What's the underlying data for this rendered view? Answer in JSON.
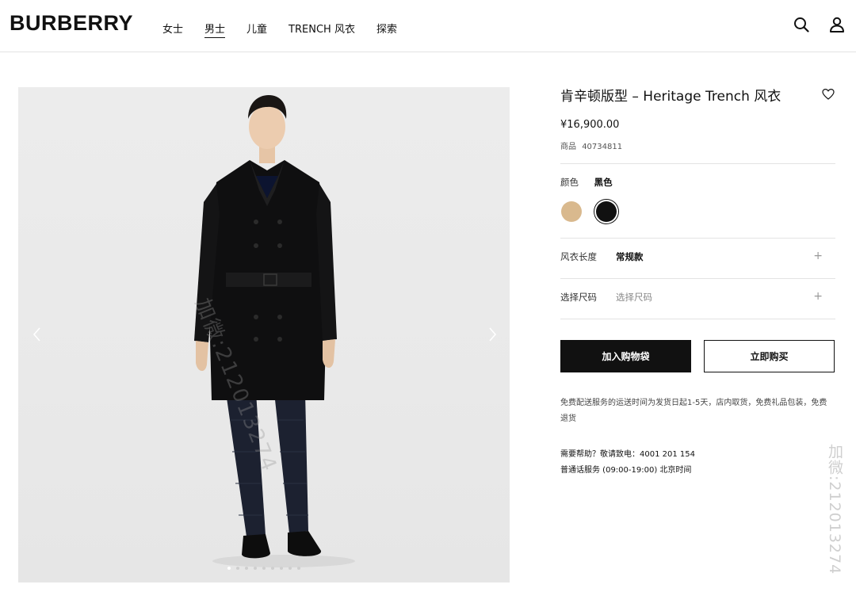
{
  "header": {
    "logo": "BURBERRY",
    "nav": [
      {
        "label": "女士"
      },
      {
        "label": "男士",
        "active": true
      },
      {
        "label": "儿童"
      },
      {
        "label": "TRENCH 风衣"
      },
      {
        "label": "探索"
      }
    ],
    "icons": [
      "search-icon",
      "account-icon"
    ]
  },
  "gallery": {
    "image": "man-in-black-trench-coat",
    "slide_count": 9,
    "active_slide": 1,
    "watermark": "加微:212013274"
  },
  "product": {
    "title": "肯辛顿版型 – Heritage Trench 风衣",
    "price": "¥16,900.00",
    "sku_label": "商品",
    "sku": "40734811",
    "color_label": "颜色",
    "color_value": "黑色",
    "swatches": [
      {
        "name": "honey",
        "color": "#d9b98e"
      },
      {
        "name": "black",
        "color": "#111111",
        "selected": true
      }
    ],
    "length_label": "风衣长度",
    "length_value": "常规款",
    "size_label": "选择尺码",
    "size_placeholder": "选择尺码",
    "plus": "+",
    "add_to_bag": "加入购物袋",
    "buy_now": "立即购买",
    "shipping_note": "免费配送服务的运送时间为发货日起1-5天，店内取货，免费礼品包装，免费退货",
    "help_line": "需要帮助？敬请致电：4001 201 154",
    "service_hours": "普通话服务 (09:00-19:00) 北京时间"
  },
  "side_watermark": "加微:212013274",
  "colors": {
    "text": "#111111",
    "divider": "#e3e3e3",
    "photo_bg": "#eaeaea"
  }
}
